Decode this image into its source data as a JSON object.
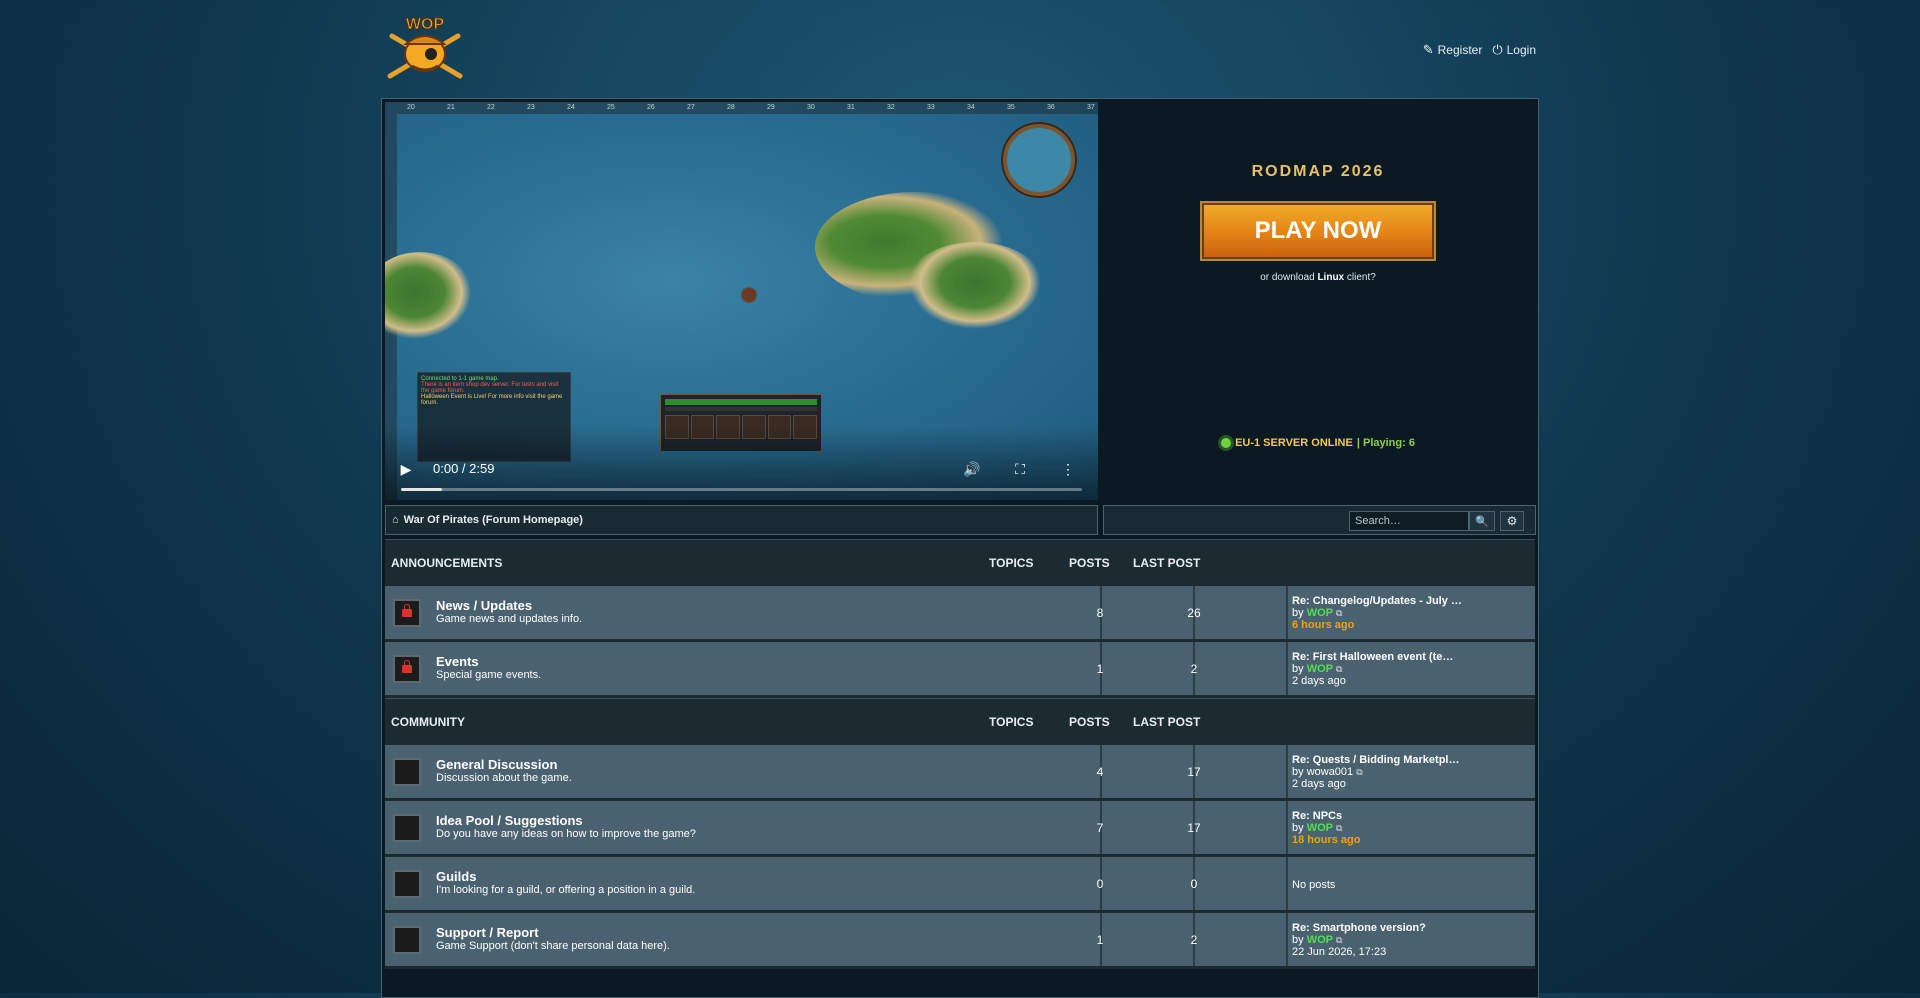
{
  "header": {
    "logo_text": "WOP",
    "register_label": "Register",
    "login_label": "Login"
  },
  "video": {
    "time": "0:00 / 2:59",
    "progress": 0.06,
    "ruler_numbers": [
      "20",
      "21",
      "22",
      "23",
      "24",
      "25",
      "26",
      "27",
      "28",
      "29",
      "30",
      "31",
      "32",
      "33",
      "34",
      "35",
      "36",
      "37"
    ],
    "chat_lines": [
      {
        "text": "Connected to 1-1 game map.",
        "color": "green"
      },
      {
        "text": "There is an item shop dev server. For tests and visit the game forum.",
        "color": "red"
      },
      {
        "text": "Halloween Event is Live! For more info visit the game forum.",
        "color": "yellow"
      }
    ]
  },
  "promo": {
    "title": "RODMAP 2026",
    "play_label": "PLAY NOW",
    "download_prefix": "or download",
    "download_link": "Linux",
    "download_suffix": "client?",
    "server_name": "EU-1 SERVER ONLINE",
    "playing": "| Playing: 6"
  },
  "nav": {
    "breadcrumb": "War Of Pirates (Forum Homepage)",
    "search_placeholder": "Search…"
  },
  "columns": {
    "topics": "TOPICS",
    "posts": "POSTS",
    "last_post": "LAST POST"
  },
  "categories": [
    {
      "name": "ANNOUNCEMENTS",
      "forums": [
        {
          "name": "News / Updates",
          "desc": "Game news and updates info.",
          "locked": true,
          "topics": "8",
          "posts": "26",
          "last_title": "Re: Changelog/Updates - July …",
          "by": "by",
          "author": "WOP",
          "author_color": "green",
          "time": "6 hours ago",
          "recent": true
        },
        {
          "name": "Events",
          "desc": "Special game events.",
          "locked": true,
          "topics": "1",
          "posts": "2",
          "last_title": "Re: First Halloween event (te…",
          "by": "by",
          "author": "WOP",
          "author_color": "green",
          "time": "2 days ago",
          "recent": false
        }
      ]
    },
    {
      "name": "COMMUNITY",
      "forums": [
        {
          "name": "General Discussion",
          "desc": "Discussion about the game.",
          "locked": false,
          "topics": "4",
          "posts": "17",
          "last_title": "Re: Quests / Bidding Marketpl…",
          "by": "by",
          "author": "wowa001",
          "author_color": "white",
          "time": "2 days ago",
          "recent": false
        },
        {
          "name": "Idea Pool / Suggestions",
          "desc": "Do you have any ideas on how to improve the game?",
          "locked": false,
          "topics": "7",
          "posts": "17",
          "last_title": "Re: NPCs",
          "by": "by",
          "author": "WOP",
          "author_color": "green",
          "time": "18 hours ago",
          "recent": true
        },
        {
          "name": "Guilds",
          "desc": "I'm looking for a guild, or offering a position in a guild.",
          "locked": false,
          "topics": "0",
          "posts": "0",
          "no_posts": "No posts"
        },
        {
          "name": "Support / Report",
          "desc": "Game Support (don't share personal data here).",
          "locked": false,
          "topics": "1",
          "posts": "2",
          "last_title": "Re: Smartphone version?",
          "by": "by",
          "author": "WOP",
          "author_color": "green",
          "time": "22 Jun 2026, 17:23",
          "recent": false
        }
      ]
    }
  ]
}
